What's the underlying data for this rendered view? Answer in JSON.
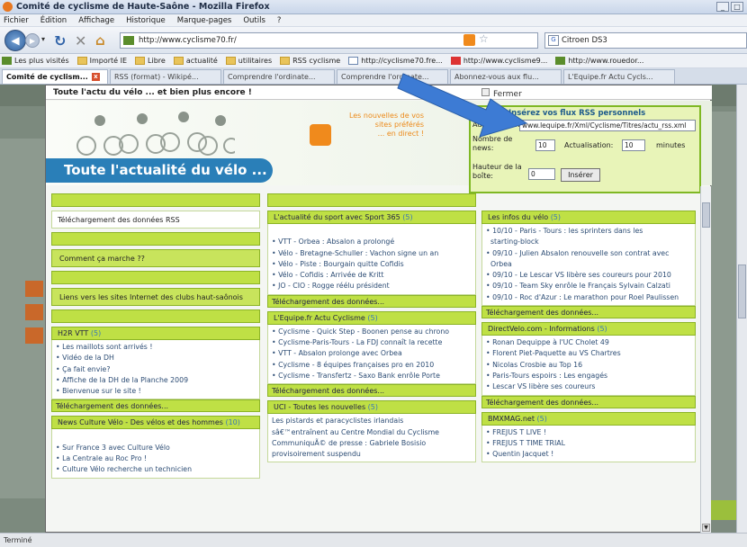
{
  "window": {
    "title": "Comité de cyclisme de Haute-Saône - Mozilla Firefox"
  },
  "menu": [
    "Fichier",
    "Édition",
    "Affichage",
    "Historique",
    "Marque-pages",
    "Outils",
    "?"
  ],
  "nav": {
    "url": "http://www.cyclisme70.fr/",
    "search": "Citroen DS3"
  },
  "bookmarks": [
    "Les plus visités",
    "Importé IE",
    "Libre",
    "actualité",
    "utilitaires",
    "RSS cyclisme",
    "http://cyclisme70.fre...",
    "http://www.cyclisme9...",
    "http://www.rouedor..."
  ],
  "tabs": [
    "Comité de cyclism...",
    "RSS (format) - Wikipé...",
    "Comprendre l'ordinate...",
    "Comprendre l'ordinate...",
    "Abonnez-vous aux flu...",
    "L'Equipe.fr Actu Cycls..."
  ],
  "modal": {
    "title": "Toute l'actu du vélo ... et bien plus encore !",
    "close_label": "Fermer",
    "banner_text": "Toute l'actualité du vélo ...",
    "rss_promo": [
      "Les nouvelles de vos",
      "sites préférés",
      "... en direct !"
    ]
  },
  "rss_panel": {
    "title": "Insérez vos flux RSS personnels",
    "address_label": "Adresse RSS:",
    "address_value": "www.lequipe.fr/Xml/Cyclisme/Titres/actu_rss.xml",
    "news_label": [
      "Nombre de",
      "news:"
    ],
    "news_value": "10",
    "refresh_label": "Actualisation:",
    "refresh_value": "10",
    "refresh_unit": "minutes",
    "height_label": [
      "Hauteur de la",
      "boîte:"
    ],
    "height_value": "0",
    "insert_label": "Insérer"
  },
  "left_col": {
    "download_rss": "Téléchargement des données RSS",
    "how_it_works": "Comment ça marche ??",
    "club_links": "Liens vers les sites Internet des clubs haut-saônois",
    "h2r": {
      "title": "H2R VTT",
      "count": "(5)",
      "items": [
        "Les maillots sont arrivés !",
        "Vidéo de la DH",
        "Ça fait envie?",
        "Affiche de la DH de la Planche 2009",
        "Bienvenue sur le site !"
      ],
      "footer": "Téléchargement des données..."
    },
    "culture": {
      "title": "News Culture Vélo - Des vélos et des hommes",
      "count": "(10)",
      "items": [
        "Sur France 3 avec Culture Vélo",
        "La Centrale au Roc Pro !",
        "Culture Vélo recherche un technicien"
      ]
    }
  },
  "mid_col": {
    "sport365": {
      "title": "L'actualité du sport avec Sport 365",
      "count": "(5)",
      "items": [
        "VTT - Orbea : Absalon a prolongé",
        "Vélo - Bretagne-Schuller : Vachon signe un an",
        "Vélo - Piste : Bourgain quitte Cofidis",
        "Vélo - Cofidis : Arrivée de Kritt",
        "JO - CIO : Rogge réélu président"
      ],
      "footer": "Téléchargement des données..."
    },
    "lequipe": {
      "title": "L'Equipe.fr Actu Cyclisme",
      "count": "(5)",
      "items": [
        "Cyclisme - Quick Step - Boonen pense au chrono",
        "Cyclisme-Paris-Tours - La FDJ connaît la recette",
        "VTT - Absalon prolonge avec Orbea",
        "Cyclisme - 8 équipes françaises pro en 2010",
        "Cyclisme - Transfertz - Saxo Bank enrôle Porte"
      ],
      "footer": "Téléchargement des données..."
    },
    "uci": {
      "title": "UCI - Toutes les nouvelles",
      "count": "(5)",
      "items": [
        "Les pistards et paracyclistes irlandais",
        "sâ€™entraînent au Centre Mondial du Cyclisme",
        "CommuniquÃ© de presse : Gabriele Bosisio",
        "provisoirement suspendu"
      ]
    }
  },
  "right_col": {
    "infos": {
      "title": "Les infos du vélo",
      "count": "(5)",
      "items": [
        "10/10 - Paris - Tours : les sprinters dans les",
        "starting-block",
        "09/10 - Julien Absalon renouvelle son contrat avec",
        "Orbea",
        "09/10 - Le Lescar VS libère ses coureurs pour 2010",
        "09/10 - Team Sky enrôle le Français Sylvain Calzati",
        "09/10 - Roc d'Azur : Le marathon pour Roel Paulissen"
      ],
      "footer": "Téléchargement des données..."
    },
    "directvelo": {
      "title": "DirectVelo.com - Informations",
      "count": "(5)",
      "items": [
        "Ronan Dequippe à l'UC Cholet 49",
        "Florent Piet-Paquette au VS Chartres",
        "Nicolas Crosbie au Top 16",
        "Paris-Tours espoirs : Les engagés",
        "Lescar VS libère ses coureurs"
      ],
      "footer": "Téléchargement des données..."
    },
    "bmx": {
      "title": "BMXMAG.net",
      "count": "(5)",
      "items": [
        "FREJUS T LIVE !",
        "FREJUS T TIME TRIAL",
        "Quentin Jacquet !"
      ]
    }
  },
  "status": "Terminé"
}
